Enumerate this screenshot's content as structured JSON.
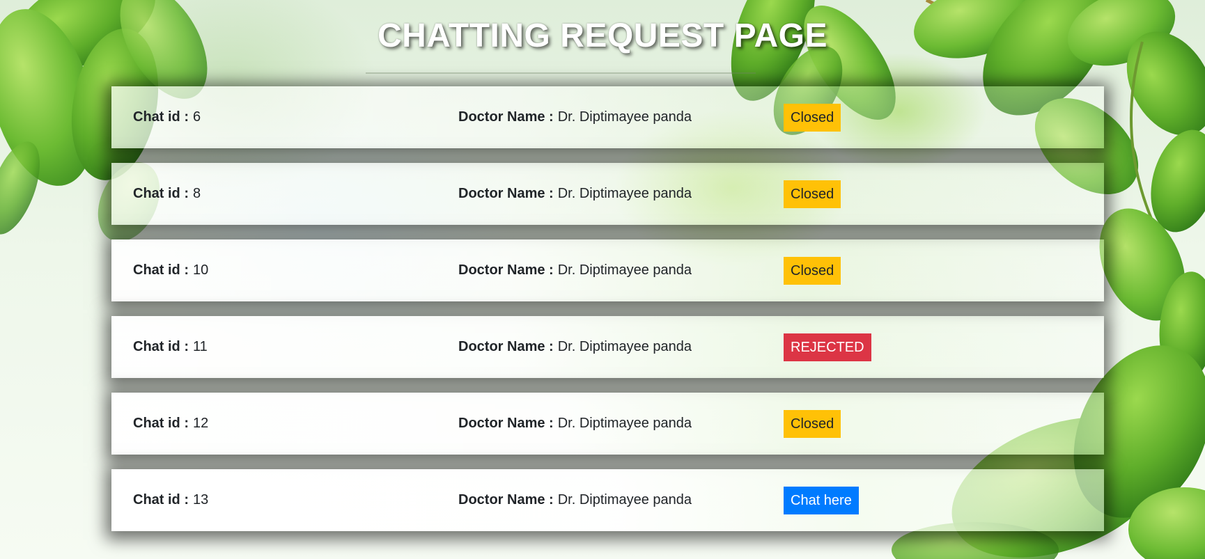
{
  "page": {
    "title": "CHATTING REQUEST PAGE"
  },
  "labels": {
    "chat_id": "Chat id :",
    "doctor_name": "Doctor Name :"
  },
  "requests": [
    {
      "chat_id": "6",
      "doctor": "Dr. Diptimayee panda",
      "status": "Closed",
      "status_type": "closed"
    },
    {
      "chat_id": "8",
      "doctor": "Dr. Diptimayee panda",
      "status": "Closed",
      "status_type": "closed"
    },
    {
      "chat_id": "10",
      "doctor": "Dr. Diptimayee panda",
      "status": "Closed",
      "status_type": "closed"
    },
    {
      "chat_id": "11",
      "doctor": "Dr. Diptimayee panda",
      "status": "REJECTED",
      "status_type": "rejected"
    },
    {
      "chat_id": "12",
      "doctor": "Dr. Diptimayee panda",
      "status": "Closed",
      "status_type": "closed"
    },
    {
      "chat_id": "13",
      "doctor": "Dr. Diptimayee panda",
      "status": "Chat here",
      "status_type": "action"
    }
  ],
  "colors": {
    "closed": "#ffc107",
    "rejected": "#dc3545",
    "action": "#007bff",
    "leaf": "#5fae2a"
  }
}
